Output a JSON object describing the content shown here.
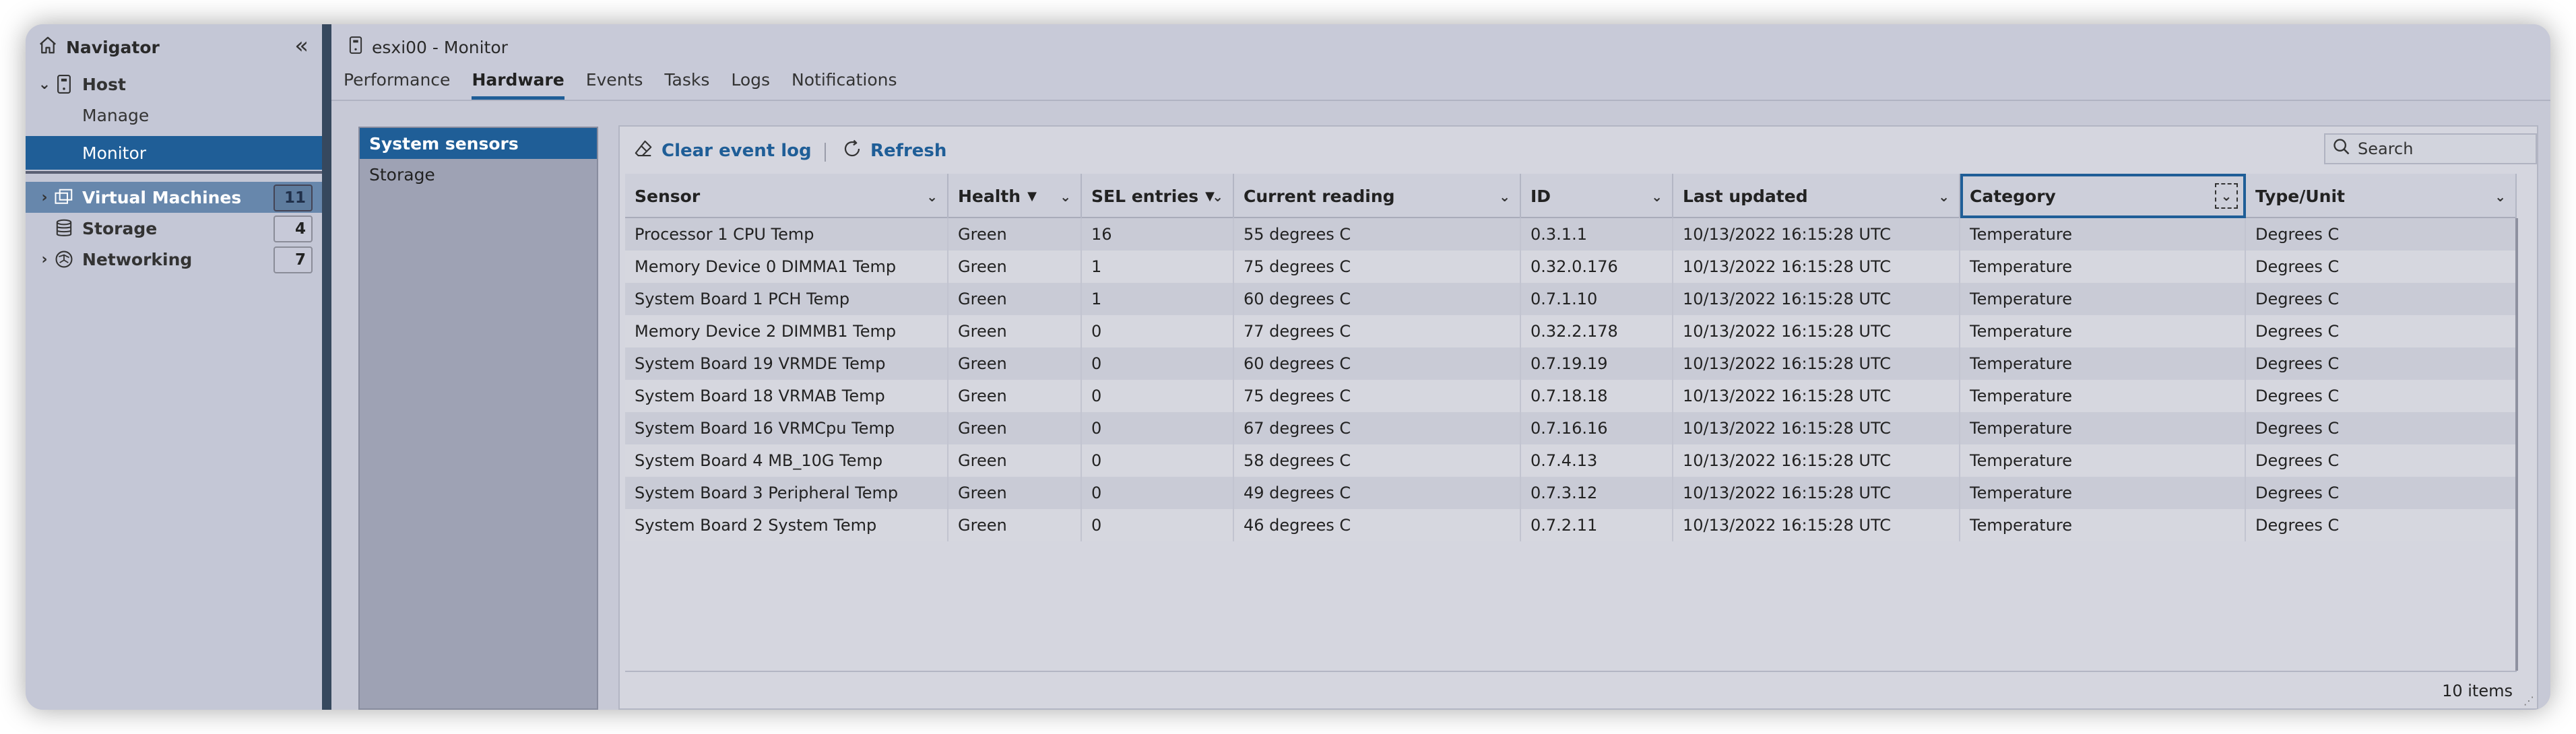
{
  "navigator": {
    "title": "Navigator",
    "items": [
      {
        "label": "Host"
      },
      {
        "label": "Manage"
      },
      {
        "label": "Monitor"
      },
      {
        "label": "Virtual Machines",
        "count": "11"
      },
      {
        "label": "Storage",
        "count": "4"
      },
      {
        "label": "Networking",
        "count": "7"
      }
    ]
  },
  "main": {
    "title": "esxi00 - Monitor",
    "tabs": [
      {
        "label": "Performance"
      },
      {
        "label": "Hardware"
      },
      {
        "label": "Events"
      },
      {
        "label": "Tasks"
      },
      {
        "label": "Logs"
      },
      {
        "label": "Notifications"
      }
    ],
    "active_tab": "Hardware"
  },
  "side_list": {
    "items": [
      {
        "label": "System sensors"
      },
      {
        "label": "Storage"
      }
    ]
  },
  "toolbar": {
    "clear_label": "Clear event log",
    "refresh_label": "Refresh",
    "search_placeholder": "Search"
  },
  "table": {
    "columns": [
      {
        "label": "Sensor"
      },
      {
        "label": "Health",
        "sort": "▼"
      },
      {
        "label": "SEL entries",
        "sort": "▼"
      },
      {
        "label": "Current reading"
      },
      {
        "label": "ID"
      },
      {
        "label": "Last updated"
      },
      {
        "label": "Category"
      },
      {
        "label": "Type/Unit"
      }
    ],
    "rows": [
      [
        "Processor 1 CPU Temp",
        "Green",
        "16",
        "55 degrees C",
        "0.3.1.1",
        "10/13/2022 16:15:28 UTC",
        "Temperature",
        "Degrees C"
      ],
      [
        "Memory Device 0 DIMMA1 Temp",
        "Green",
        "1",
        "75 degrees C",
        "0.32.0.176",
        "10/13/2022 16:15:28 UTC",
        "Temperature",
        "Degrees C"
      ],
      [
        "System Board 1 PCH Temp",
        "Green",
        "1",
        "60 degrees C",
        "0.7.1.10",
        "10/13/2022 16:15:28 UTC",
        "Temperature",
        "Degrees C"
      ],
      [
        "Memory Device 2 DIMMB1 Temp",
        "Green",
        "0",
        "77 degrees C",
        "0.32.2.178",
        "10/13/2022 16:15:28 UTC",
        "Temperature",
        "Degrees C"
      ],
      [
        "System Board 19 VRMDE Temp",
        "Green",
        "0",
        "60 degrees C",
        "0.7.19.19",
        "10/13/2022 16:15:28 UTC",
        "Temperature",
        "Degrees C"
      ],
      [
        "System Board 18 VRMAB Temp",
        "Green",
        "0",
        "75 degrees C",
        "0.7.18.18",
        "10/13/2022 16:15:28 UTC",
        "Temperature",
        "Degrees C"
      ],
      [
        "System Board 16 VRMCpu Temp",
        "Green",
        "0",
        "67 degrees C",
        "0.7.16.16",
        "10/13/2022 16:15:28 UTC",
        "Temperature",
        "Degrees C"
      ],
      [
        "System Board 4 MB_10G Temp",
        "Green",
        "0",
        "58 degrees C",
        "0.7.4.13",
        "10/13/2022 16:15:28 UTC",
        "Temperature",
        "Degrees C"
      ],
      [
        "System Board 3 Peripheral Temp",
        "Green",
        "0",
        "49 degrees C",
        "0.7.3.12",
        "10/13/2022 16:15:28 UTC",
        "Temperature",
        "Degrees C"
      ],
      [
        "System Board 2 System Temp",
        "Green",
        "0",
        "46 degrees C",
        "0.7.2.11",
        "10/13/2022 16:15:28 UTC",
        "Temperature",
        "Degrees C"
      ]
    ],
    "footer": "10 items"
  },
  "colors": {
    "accent": "#1f5e97",
    "selected_vm_row": "#6787ac"
  }
}
